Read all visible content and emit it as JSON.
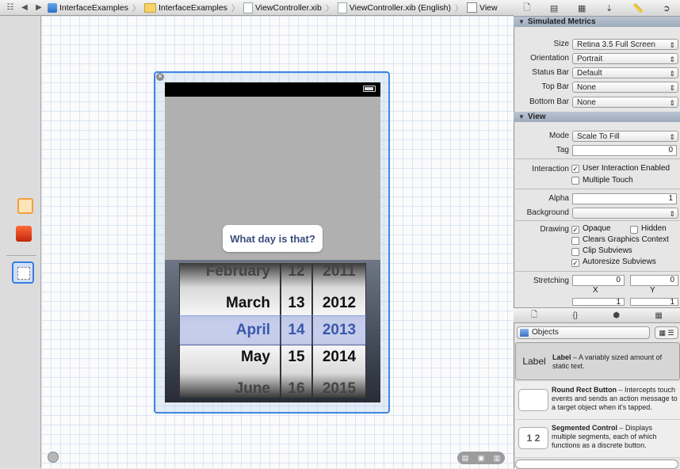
{
  "jumpbar": {
    "breadcrumbs": [
      "InterfaceExamples",
      "InterfaceExamples",
      "ViewController.xib",
      "ViewController.xib (English)",
      "View"
    ]
  },
  "canvas": {
    "label_text": "What day is that?",
    "picker": {
      "months": [
        "February",
        "March",
        "April",
        "May",
        "June"
      ],
      "days": [
        "12",
        "13",
        "14",
        "15",
        "16"
      ],
      "years": [
        "2011",
        "2012",
        "2013",
        "2014",
        "2015"
      ],
      "selected_index": 2
    }
  },
  "inspector": {
    "simulated_metrics": {
      "header": "Simulated Metrics",
      "size_label": "Size",
      "size_value": "Retina 3.5 Full Screen",
      "orientation_label": "Orientation",
      "orientation_value": "Portrait",
      "status_bar_label": "Status Bar",
      "status_bar_value": "Default",
      "top_bar_label": "Top Bar",
      "top_bar_value": "None",
      "bottom_bar_label": "Bottom Bar",
      "bottom_bar_value": "None"
    },
    "view": {
      "header": "View",
      "mode_label": "Mode",
      "mode_value": "Scale To Fill",
      "tag_label": "Tag",
      "tag_value": "0",
      "interaction_label": "Interaction",
      "user_interaction": "User Interaction Enabled",
      "user_interaction_checked": true,
      "multiple_touch": "Multiple Touch",
      "multiple_touch_checked": false,
      "alpha_label": "Alpha",
      "alpha_value": "1",
      "background_label": "Background",
      "drawing_label": "Drawing",
      "opaque": "Opaque",
      "opaque_checked": true,
      "hidden": "Hidden",
      "hidden_checked": false,
      "clears_graphics": "Clears Graphics Context",
      "clears_graphics_checked": false,
      "clip_subviews": "Clip Subviews",
      "clip_subviews_checked": false,
      "autoresize_subviews": "Autoresize Subviews",
      "autoresize_subviews_checked": true,
      "stretching_label": "Stretching",
      "stretch_x": "0",
      "stretch_y": "0",
      "stretch_w": "1",
      "stretch_h": "1",
      "x_label": "X",
      "y_label": "Y"
    }
  },
  "library": {
    "filter_value": "Objects",
    "items": [
      {
        "thumb": "Label",
        "name": "Label",
        "description": " – A variably sized amount of static text."
      },
      {
        "thumb": "",
        "name": "Round Rect Button",
        "description": " – Intercepts touch events and sends an action message to a target object when it's tapped."
      },
      {
        "thumb": "1 2",
        "name": "Segmented Control",
        "description": " – Displays multiple segments, each of which functions as a discrete button."
      }
    ]
  }
}
